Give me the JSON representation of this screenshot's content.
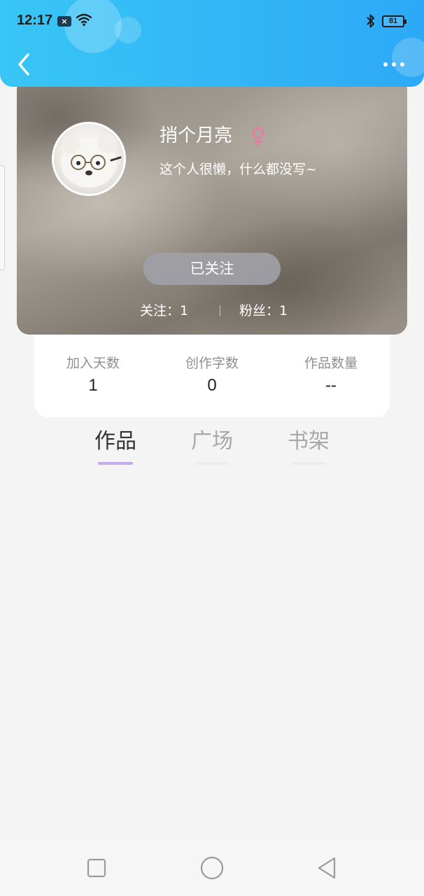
{
  "status_bar": {
    "time": "12:17",
    "notification_badge": "×",
    "battery_level": "81"
  },
  "header": {
    "back_icon": "chevron-left-icon",
    "more_icon": "more-dots-icon"
  },
  "profile": {
    "username": "捎个月亮",
    "gender_symbol": "♀",
    "gender_color": "#e97aa0",
    "bio": "这个人很懒，什么都没写~",
    "follow_button_label": "已关注",
    "following_text": "关注：1",
    "fans_text": "粉丝：1"
  },
  "stats": [
    {
      "label": "加入天数",
      "value": "1"
    },
    {
      "label": "创作字数",
      "value": "0"
    },
    {
      "label": "作品数量",
      "value": "--"
    }
  ],
  "tabs": [
    {
      "label": "作品",
      "active": true
    },
    {
      "label": "广场",
      "active": false
    },
    {
      "label": "书架",
      "active": false
    }
  ],
  "colors": {
    "header_gradient_start": "#38c6f5",
    "header_gradient_end": "#2da9f7",
    "tab_indicator": "#c7a6f0"
  },
  "nav_bar": {
    "icons": [
      "square-icon",
      "circle-home-icon",
      "triangle-back-icon"
    ]
  }
}
